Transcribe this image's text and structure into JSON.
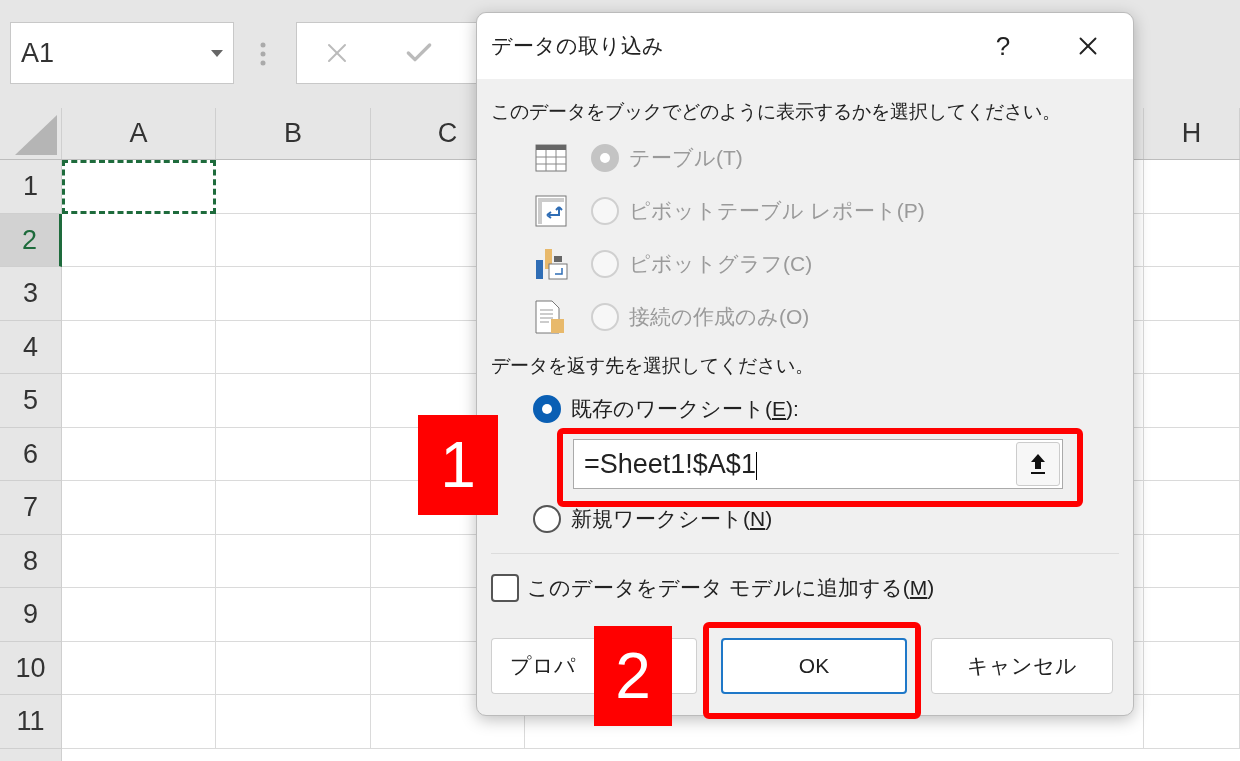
{
  "name_box": {
    "value": "A1"
  },
  "sheet": {
    "columns": [
      {
        "label": "A",
        "selected": false
      },
      {
        "label": "B",
        "selected": false
      },
      {
        "label": "C",
        "selected": false
      },
      {
        "label": "H",
        "selected": false
      }
    ],
    "rows": [
      {
        "label": "1",
        "selected": false,
        "marquee": true
      },
      {
        "label": "2",
        "selected": true,
        "marquee": false
      },
      {
        "label": "3",
        "selected": false,
        "marquee": false
      },
      {
        "label": "4",
        "selected": false,
        "marquee": false
      },
      {
        "label": "5",
        "selected": false,
        "marquee": false
      },
      {
        "label": "6",
        "selected": false,
        "marquee": false
      },
      {
        "label": "7",
        "selected": false,
        "marquee": false
      },
      {
        "label": "8",
        "selected": false,
        "marquee": false
      },
      {
        "label": "9",
        "selected": false,
        "marquee": false
      },
      {
        "label": "10",
        "selected": false,
        "marquee": false
      },
      {
        "label": "11",
        "selected": false,
        "marquee": false
      }
    ]
  },
  "dialog": {
    "title": "データの取り込み",
    "help": "?",
    "prompt_view": "このデータをブックでどのように表示するかを選択してください。",
    "view_options": [
      {
        "kind": "table",
        "label": "テーブル(T)",
        "selected": true,
        "disabled": true
      },
      {
        "kind": "pivot_table",
        "label": "ピボットテーブル レポート(P)",
        "selected": false,
        "disabled": true
      },
      {
        "kind": "pivot_chart",
        "label": "ピボットグラフ(C)",
        "selected": false,
        "disabled": true
      },
      {
        "kind": "connection",
        "label": "接続の作成のみ(O)",
        "selected": false,
        "disabled": true
      }
    ],
    "prompt_destination": "データを返す先を選択してください。",
    "destinations": [
      {
        "kind": "existing",
        "label_before": "既存のワークシート(",
        "access_key": "E",
        "label_after": "):",
        "selected": true
      },
      {
        "kind": "new",
        "label_before": "新規ワークシート(",
        "access_key": "N",
        "label_after": ")",
        "selected": false
      }
    ],
    "reference": {
      "value": "=Sheet1!$A$1"
    },
    "data_model": {
      "label_before": "このデータをデータ モデルに追加する(",
      "access_key": "M",
      "label_after": ")",
      "checked": false
    },
    "buttons": [
      {
        "label": "プロパ",
        "default": false
      },
      {
        "label": "OK",
        "default": true
      },
      {
        "label": "キャンセル",
        "default": false
      }
    ]
  },
  "callouts": [
    {
      "label": "1"
    },
    {
      "label": "2"
    }
  ]
}
